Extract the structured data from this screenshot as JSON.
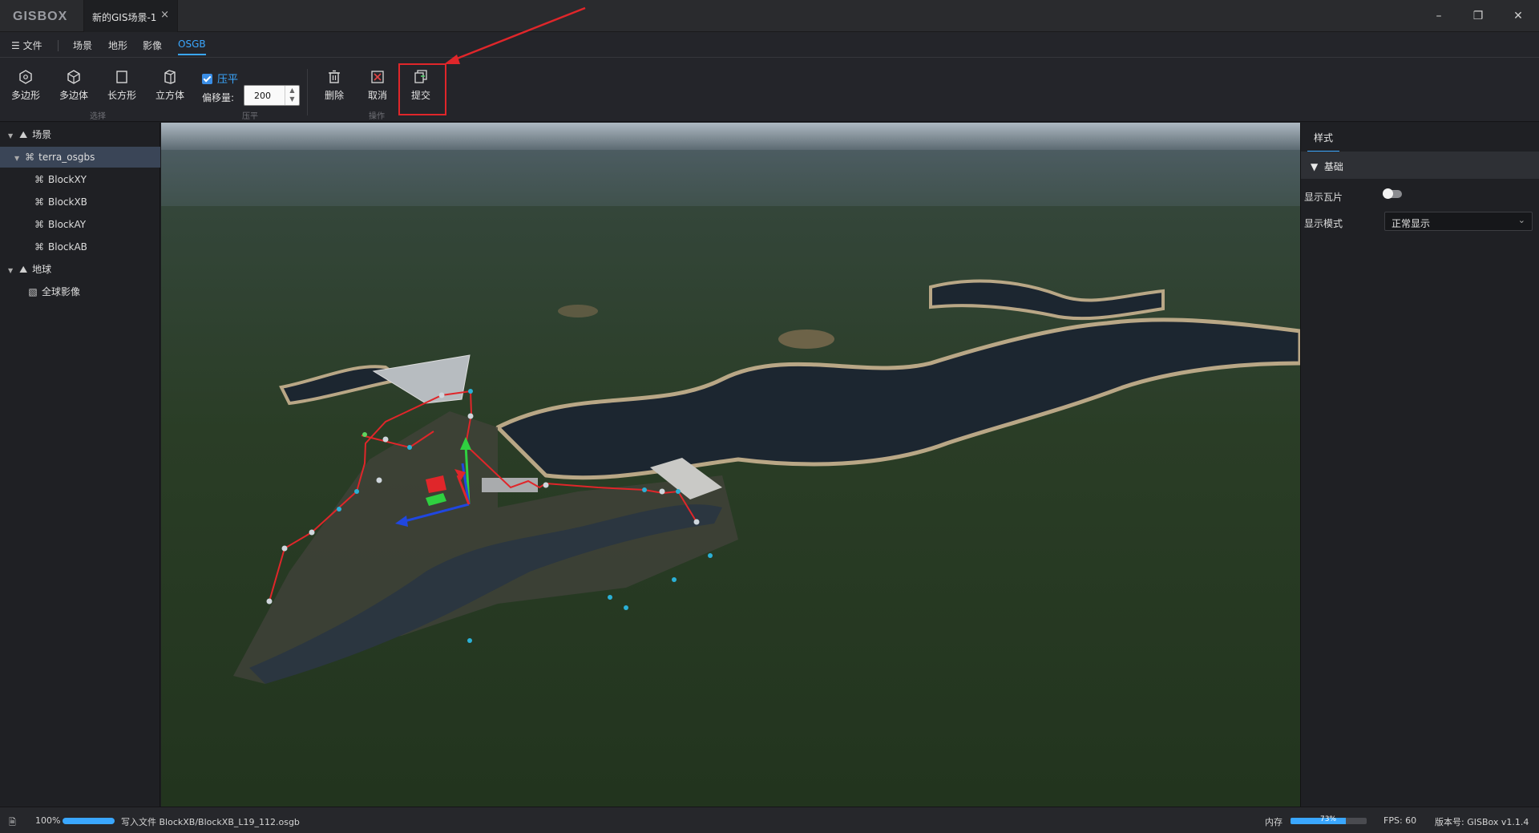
{
  "app": {
    "logo": "GISBOX",
    "tab_title": "新的GIS场景-1",
    "tab_close": "×",
    "min": "–",
    "restore": "❐",
    "close": "✕"
  },
  "menu": {
    "file": "文件",
    "items": [
      "场景",
      "地形",
      "影像",
      "OSGB"
    ],
    "active": "OSGB"
  },
  "toolbar": {
    "select_tools": [
      {
        "label": "多边形",
        "icon": "polygon-icon"
      },
      {
        "label": "多边体",
        "icon": "polyhedron-icon"
      },
      {
        "label": "长方形",
        "icon": "rectangle-icon"
      },
      {
        "label": "立方体",
        "icon": "cube-icon"
      }
    ],
    "group_select": "选择",
    "flatten_label": "压平",
    "flatten_checked": true,
    "offset_label": "偏移量:",
    "offset_value": "200",
    "group_flatten": "压平",
    "delete_label": "删除",
    "cancel_label": "取消",
    "group_ops": "操作",
    "submit_label": "提交"
  },
  "tree": {
    "items": [
      {
        "label": "场景",
        "level": 0,
        "icon": "scene-icon",
        "expanded": true
      },
      {
        "label": "terra_osgbs",
        "level": 1,
        "icon": "model-icon",
        "expanded": true,
        "selected": true
      },
      {
        "label": "BlockXY",
        "level": 2,
        "icon": "model-icon"
      },
      {
        "label": "BlockXB",
        "level": 2,
        "icon": "model-icon"
      },
      {
        "label": "BlockAY",
        "level": 2,
        "icon": "model-icon"
      },
      {
        "label": "BlockAB",
        "level": 2,
        "icon": "model-icon"
      },
      {
        "label": "地球",
        "level": 0,
        "icon": "globe-icon",
        "expanded": true
      },
      {
        "label": "全球影像",
        "level": 1,
        "icon": "imagery-icon"
      }
    ]
  },
  "panel": {
    "tab": "样式",
    "section": "基础",
    "show_tiles_label": "显示瓦片",
    "show_tiles_on": false,
    "display_mode_label": "显示模式",
    "display_mode_value": "正常显示"
  },
  "status": {
    "progress_text": "100%",
    "progress": 1.0,
    "message": "写入文件 BlockXB/BlockXB_L19_112.osgb",
    "memory_label": "内存",
    "memory_value": "73%",
    "memory": 0.73,
    "fps": "FPS: 60",
    "version": "版本号: GISBox v1.1.4"
  },
  "colors": {
    "accent": "#3aa7ff",
    "highlight": "#e0262a",
    "polygon": "#e0262a"
  }
}
